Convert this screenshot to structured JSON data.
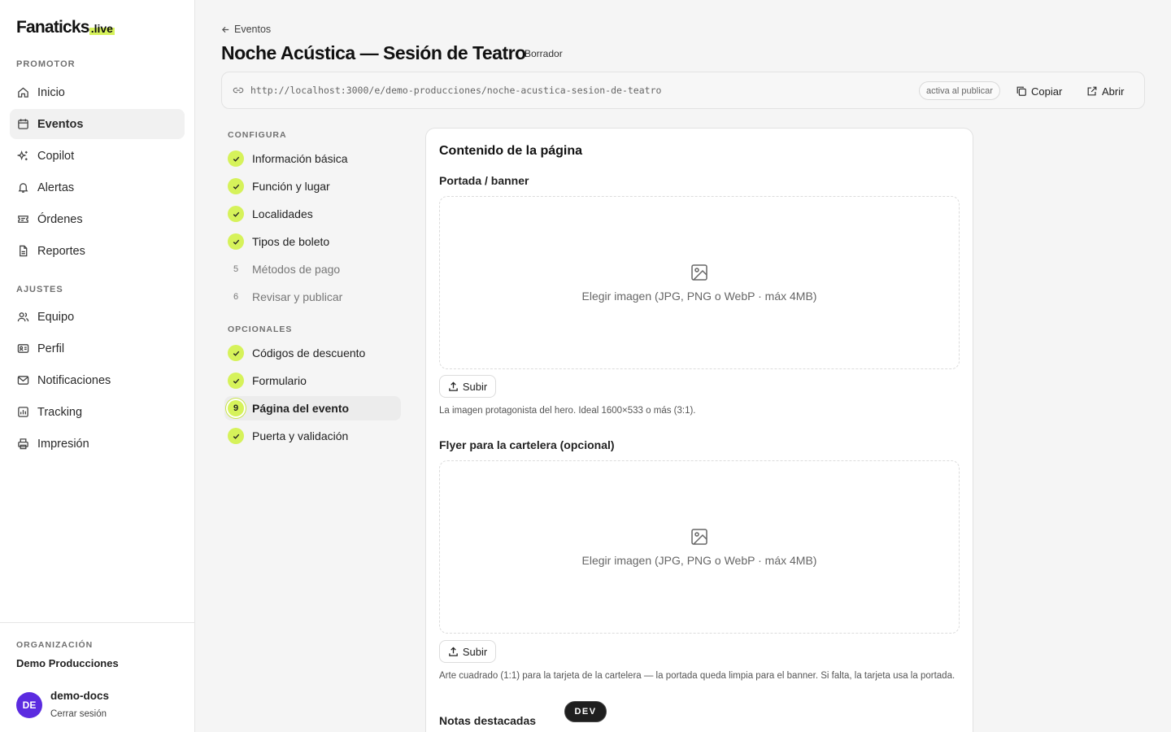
{
  "brand": {
    "name": "Fanaticks",
    "suffix": ".live",
    "accent": "#d6f25a"
  },
  "sidebar": {
    "section_promoter": "PROMOTOR",
    "promoter_items": [
      {
        "label": "Inicio",
        "icon": "home-icon"
      },
      {
        "label": "Eventos",
        "icon": "calendar-icon",
        "active": true
      },
      {
        "label": "Copilot",
        "icon": "sparkle-icon"
      },
      {
        "label": "Alertas",
        "icon": "bell-icon"
      },
      {
        "label": "Órdenes",
        "icon": "ticket-icon"
      },
      {
        "label": "Reportes",
        "icon": "file-icon"
      }
    ],
    "section_settings": "AJUSTES",
    "settings_items": [
      {
        "label": "Equipo",
        "icon": "users-icon"
      },
      {
        "label": "Perfil",
        "icon": "id-card-icon"
      },
      {
        "label": "Notificaciones",
        "icon": "mail-icon"
      },
      {
        "label": "Tracking",
        "icon": "chart-icon"
      },
      {
        "label": "Impresión",
        "icon": "printer-icon"
      }
    ],
    "org_label": "ORGANIZACIÓN",
    "org_name": "Demo Producciones",
    "user": {
      "initials": "DE",
      "name": "demo-docs",
      "logout": "Cerrar sesión"
    }
  },
  "header": {
    "back_label": "Eventos",
    "title": "Noche Acústica — Sesión de Teatro",
    "status": "Borrador",
    "url": "http://localhost:3000/e/demo-producciones/noche-acustica-sesion-de-teatro",
    "url_status": "activa al publicar",
    "copy_label": "Copiar",
    "open_label": "Abrir"
  },
  "steps": {
    "configure_label": "CONFIGURA",
    "configure": [
      {
        "label": "Información básica",
        "state": "done"
      },
      {
        "label": "Función y lugar",
        "state": "done"
      },
      {
        "label": "Localidades",
        "state": "done"
      },
      {
        "label": "Tipos de boleto",
        "state": "done"
      },
      {
        "label": "Métodos de pago",
        "state": "pending",
        "number": "5"
      },
      {
        "label": "Revisar y publicar",
        "state": "pending",
        "number": "6"
      }
    ],
    "optional_label": "OPCIONALES",
    "optional": [
      {
        "label": "Códigos de descuento",
        "state": "done"
      },
      {
        "label": "Formulario",
        "state": "done"
      },
      {
        "label": "Página del evento",
        "state": "current",
        "number": "9"
      },
      {
        "label": "Puerta y validación",
        "state": "done"
      }
    ]
  },
  "content": {
    "title": "Contenido de la página",
    "banner": {
      "label": "Portada / banner",
      "dropzone_text": "Elegir imagen (JPG, PNG o WebP · máx 4MB)",
      "upload_label": "Subir",
      "help": "La imagen protagonista del hero. Ideal 1600×533 o más (3:1)."
    },
    "flyer": {
      "label": "Flyer para la cartelera (opcional)",
      "dropzone_text": "Elegir imagen (JPG, PNG o WebP · máx 4MB)",
      "upload_label": "Subir",
      "help": "Arte cuadrado (1:1) para la tarjeta de la cartelera — la portada queda limpia para el banner. Si falta, la tarjeta usa la portada."
    },
    "notes_label": "Notas destacadas"
  },
  "dev_badge": "DEV"
}
